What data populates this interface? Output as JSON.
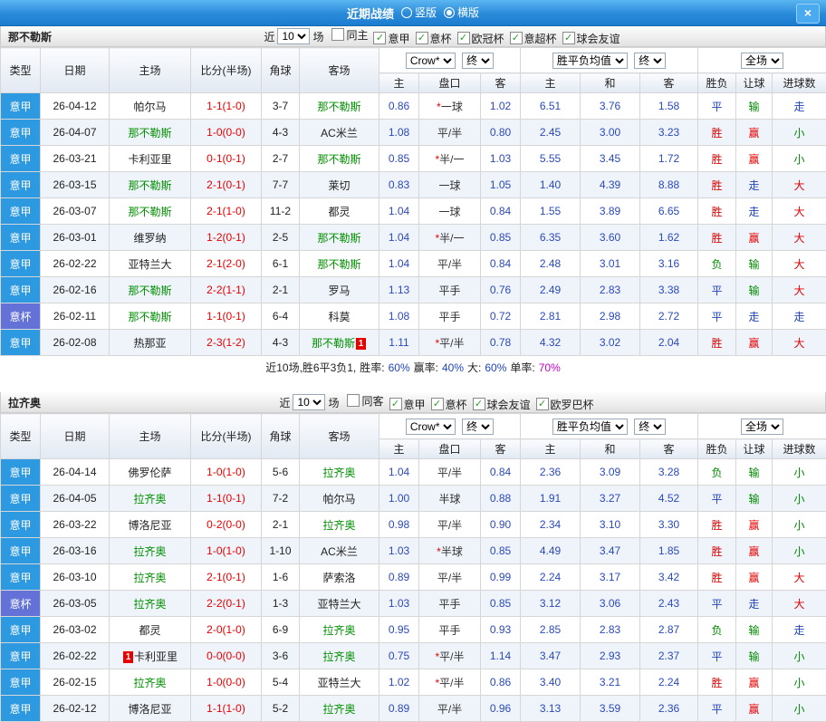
{
  "colors": {
    "red": "#e60000",
    "green": "#008a00",
    "blue": "#2144bd",
    "magenta": "#c400c4"
  },
  "titlebar": {
    "title": "近期战绩",
    "layout_options": [
      {
        "label": "竖版",
        "selected": false
      },
      {
        "label": "横版",
        "selected": true
      }
    ],
    "close_label": "×"
  },
  "filters_common": {
    "recent_label": "近",
    "recent_value": "10",
    "games_label": "场",
    "odds_company": "Crow*",
    "odds_stage": "终",
    "europe_metric": "胜平负均值",
    "europe_stage": "终",
    "scope": "全场"
  },
  "table_headers": {
    "type": "类型",
    "date": "日期",
    "home": "主场",
    "score": "比分(半场)",
    "corner": "角球",
    "away": "客场",
    "asia_home": "主",
    "handicap": "盘口",
    "asia_away": "客",
    "eu_home": "主",
    "eu_draw": "和",
    "eu_away": "客",
    "result": "胜负",
    "handicap_result": "让球",
    "goals": "进球数"
  },
  "sections": [
    {
      "team": "那不勒斯",
      "checkboxes": [
        {
          "label": "同主",
          "checked": false
        },
        {
          "label": "意甲",
          "checked": true
        },
        {
          "label": "意杯",
          "checked": true
        },
        {
          "label": "欧冠杯",
          "checked": true
        },
        {
          "label": "意超杯",
          "checked": true
        },
        {
          "label": "球会友谊",
          "checked": true
        }
      ],
      "rows": [
        {
          "type": "意甲",
          "type_style": "league",
          "date": "26-04-12",
          "home": "帕尔马",
          "home_focus": false,
          "score": "1-1(1-0)",
          "corner": "3-7",
          "away": "那不勒斯",
          "away_focus": true,
          "asia_home": "0.86",
          "handicap": "*一球",
          "asia_away": "1.02",
          "eu_home": "6.51",
          "eu_draw": "3.76",
          "eu_away": "1.58",
          "result": {
            "t": "平",
            "c": "blue"
          },
          "handicap_res": {
            "t": "输",
            "c": "green"
          },
          "goals_res": {
            "t": "走",
            "c": "blue"
          }
        },
        {
          "type": "意甲",
          "type_style": "league",
          "date": "26-04-07",
          "home": "那不勒斯",
          "home_focus": true,
          "score": "1-0(0-0)",
          "corner": "4-3",
          "away": "AC米兰",
          "away_focus": false,
          "asia_home": "1.08",
          "handicap": "平/半",
          "asia_away": "0.80",
          "eu_home": "2.45",
          "eu_draw": "3.00",
          "eu_away": "3.23",
          "result": {
            "t": "胜",
            "c": "red"
          },
          "handicap_res": {
            "t": "赢",
            "c": "red"
          },
          "goals_res": {
            "t": "小",
            "c": "green"
          }
        },
        {
          "type": "意甲",
          "type_style": "league",
          "date": "26-03-21",
          "home": "卡利亚里",
          "home_focus": false,
          "score": "0-1(0-1)",
          "corner": "2-7",
          "away": "那不勒斯",
          "away_focus": true,
          "asia_home": "0.85",
          "handicap": "*半/一",
          "asia_away": "1.03",
          "eu_home": "5.55",
          "eu_draw": "3.45",
          "eu_away": "1.72",
          "result": {
            "t": "胜",
            "c": "red"
          },
          "handicap_res": {
            "t": "赢",
            "c": "red"
          },
          "goals_res": {
            "t": "小",
            "c": "green"
          }
        },
        {
          "type": "意甲",
          "type_style": "league",
          "date": "26-03-15",
          "home": "那不勒斯",
          "home_focus": true,
          "score": "2-1(0-1)",
          "corner": "7-7",
          "away": "莱切",
          "away_focus": false,
          "asia_home": "0.83",
          "handicap": "一球",
          "asia_away": "1.05",
          "eu_home": "1.40",
          "eu_draw": "4.39",
          "eu_away": "8.88",
          "result": {
            "t": "胜",
            "c": "red"
          },
          "handicap_res": {
            "t": "走",
            "c": "blue"
          },
          "goals_res": {
            "t": "大",
            "c": "red"
          }
        },
        {
          "type": "意甲",
          "type_style": "league",
          "date": "26-03-07",
          "home": "那不勒斯",
          "home_focus": true,
          "score": "2-1(1-0)",
          "corner": "11-2",
          "away": "都灵",
          "away_focus": false,
          "asia_home": "1.04",
          "handicap": "一球",
          "asia_away": "0.84",
          "eu_home": "1.55",
          "eu_draw": "3.89",
          "eu_away": "6.65",
          "result": {
            "t": "胜",
            "c": "red"
          },
          "handicap_res": {
            "t": "走",
            "c": "blue"
          },
          "goals_res": {
            "t": "大",
            "c": "red"
          }
        },
        {
          "type": "意甲",
          "type_style": "league",
          "date": "26-03-01",
          "home": "维罗纳",
          "home_focus": false,
          "score": "1-2(0-1)",
          "corner": "2-5",
          "away": "那不勒斯",
          "away_focus": true,
          "asia_home": "1.04",
          "handicap": "*半/一",
          "asia_away": "0.85",
          "eu_home": "6.35",
          "eu_draw": "3.60",
          "eu_away": "1.62",
          "result": {
            "t": "胜",
            "c": "red"
          },
          "handicap_res": {
            "t": "赢",
            "c": "red"
          },
          "goals_res": {
            "t": "大",
            "c": "red"
          }
        },
        {
          "type": "意甲",
          "type_style": "league",
          "date": "26-02-22",
          "home": "亚特兰大",
          "home_focus": false,
          "score": "2-1(2-0)",
          "corner": "6-1",
          "away": "那不勒斯",
          "away_focus": true,
          "asia_home": "1.04",
          "handicap": "平/半",
          "asia_away": "0.84",
          "eu_home": "2.48",
          "eu_draw": "3.01",
          "eu_away": "3.16",
          "result": {
            "t": "负",
            "c": "green"
          },
          "handicap_res": {
            "t": "输",
            "c": "green"
          },
          "goals_res": {
            "t": "大",
            "c": "red"
          }
        },
        {
          "type": "意甲",
          "type_style": "league",
          "date": "26-02-16",
          "home": "那不勒斯",
          "home_focus": true,
          "score": "2-2(1-1)",
          "corner": "2-1",
          "away": "罗马",
          "away_focus": false,
          "asia_home": "1.13",
          "handicap": "平手",
          "asia_away": "0.76",
          "eu_home": "2.49",
          "eu_draw": "2.83",
          "eu_away": "3.38",
          "result": {
            "t": "平",
            "c": "blue"
          },
          "handicap_res": {
            "t": "输",
            "c": "green"
          },
          "goals_res": {
            "t": "大",
            "c": "red"
          }
        },
        {
          "type": "意杯",
          "type_style": "cup",
          "date": "26-02-11",
          "home": "那不勒斯",
          "home_focus": true,
          "score": "1-1(0-1)",
          "corner": "6-4",
          "away": "科莫",
          "away_focus": false,
          "asia_home": "1.08",
          "handicap": "平手",
          "asia_away": "0.72",
          "eu_home": "2.81",
          "eu_draw": "2.98",
          "eu_away": "2.72",
          "result": {
            "t": "平",
            "c": "blue"
          },
          "handicap_res": {
            "t": "走",
            "c": "blue"
          },
          "goals_res": {
            "t": "走",
            "c": "blue"
          }
        },
        {
          "type": "意甲",
          "type_style": "league",
          "date": "26-02-08",
          "home": "热那亚",
          "home_focus": false,
          "score": "2-3(1-2)",
          "corner": "4-3",
          "away": "那不勒斯",
          "away_focus": true,
          "away_badge": "1",
          "asia_home": "1.11",
          "handicap": "*平/半",
          "asia_away": "0.78",
          "eu_home": "4.32",
          "eu_draw": "3.02",
          "eu_away": "2.04",
          "result": {
            "t": "胜",
            "c": "red"
          },
          "handicap_res": {
            "t": "赢",
            "c": "red"
          },
          "goals_res": {
            "t": "大",
            "c": "red"
          }
        }
      ],
      "summary": {
        "prefix": "近10场,胜6平3负1,",
        "stats": [
          {
            "label": "胜率:",
            "value": "60%",
            "color": "blue"
          },
          {
            "label": "赢率:",
            "value": "40%",
            "color": "blue"
          },
          {
            "label": "大:",
            "value": "60%",
            "color": "blue"
          },
          {
            "label": "单率:",
            "value": "70%",
            "color": "magenta"
          }
        ]
      }
    },
    {
      "team": "拉齐奥",
      "checkboxes": [
        {
          "label": "同客",
          "checked": false
        },
        {
          "label": "意甲",
          "checked": true
        },
        {
          "label": "意杯",
          "checked": true
        },
        {
          "label": "球会友谊",
          "checked": true
        },
        {
          "label": "欧罗巴杯",
          "checked": true
        }
      ],
      "rows": [
        {
          "type": "意甲",
          "type_style": "league",
          "date": "26-04-14",
          "home": "佛罗伦萨",
          "home_focus": false,
          "score": "1-0(1-0)",
          "corner": "5-6",
          "away": "拉齐奥",
          "away_focus": true,
          "asia_home": "1.04",
          "handicap": "平/半",
          "asia_away": "0.84",
          "eu_home": "2.36",
          "eu_draw": "3.09",
          "eu_away": "3.28",
          "result": {
            "t": "负",
            "c": "green"
          },
          "handicap_res": {
            "t": "输",
            "c": "green"
          },
          "goals_res": {
            "t": "小",
            "c": "green"
          }
        },
        {
          "type": "意甲",
          "type_style": "league",
          "date": "26-04-05",
          "home": "拉齐奥",
          "home_focus": true,
          "score": "1-1(0-1)",
          "corner": "7-2",
          "away": "帕尔马",
          "away_focus": false,
          "asia_home": "1.00",
          "handicap": "半球",
          "asia_away": "0.88",
          "eu_home": "1.91",
          "eu_draw": "3.27",
          "eu_away": "4.52",
          "result": {
            "t": "平",
            "c": "blue"
          },
          "handicap_res": {
            "t": "输",
            "c": "green"
          },
          "goals_res": {
            "t": "小",
            "c": "green"
          }
        },
        {
          "type": "意甲",
          "type_style": "league",
          "date": "26-03-22",
          "home": "博洛尼亚",
          "home_focus": false,
          "score": "0-2(0-0)",
          "corner": "2-1",
          "away": "拉齐奥",
          "away_focus": true,
          "asia_home": "0.98",
          "handicap": "平/半",
          "asia_away": "0.90",
          "eu_home": "2.34",
          "eu_draw": "3.10",
          "eu_away": "3.30",
          "result": {
            "t": "胜",
            "c": "red"
          },
          "handicap_res": {
            "t": "赢",
            "c": "red"
          },
          "goals_res": {
            "t": "小",
            "c": "green"
          }
        },
        {
          "type": "意甲",
          "type_style": "league",
          "date": "26-03-16",
          "home": "拉齐奥",
          "home_focus": true,
          "score": "1-0(1-0)",
          "corner": "1-10",
          "away": "AC米兰",
          "away_focus": false,
          "asia_home": "1.03",
          "handicap": "*半球",
          "asia_away": "0.85",
          "eu_home": "4.49",
          "eu_draw": "3.47",
          "eu_away": "1.85",
          "result": {
            "t": "胜",
            "c": "red"
          },
          "handicap_res": {
            "t": "赢",
            "c": "red"
          },
          "goals_res": {
            "t": "小",
            "c": "green"
          }
        },
        {
          "type": "意甲",
          "type_style": "league",
          "date": "26-03-10",
          "home": "拉齐奥",
          "home_focus": true,
          "score": "2-1(0-1)",
          "corner": "1-6",
          "away": "萨索洛",
          "away_focus": false,
          "asia_home": "0.89",
          "handicap": "平/半",
          "asia_away": "0.99",
          "eu_home": "2.24",
          "eu_draw": "3.17",
          "eu_away": "3.42",
          "result": {
            "t": "胜",
            "c": "red"
          },
          "handicap_res": {
            "t": "赢",
            "c": "red"
          },
          "goals_res": {
            "t": "大",
            "c": "red"
          }
        },
        {
          "type": "意杯",
          "type_style": "cup",
          "date": "26-03-05",
          "home": "拉齐奥",
          "home_focus": true,
          "score": "2-2(0-1)",
          "corner": "1-3",
          "away": "亚特兰大",
          "away_focus": false,
          "asia_home": "1.03",
          "handicap": "平手",
          "asia_away": "0.85",
          "eu_home": "3.12",
          "eu_draw": "3.06",
          "eu_away": "2.43",
          "result": {
            "t": "平",
            "c": "blue"
          },
          "handicap_res": {
            "t": "走",
            "c": "blue"
          },
          "goals_res": {
            "t": "大",
            "c": "red"
          }
        },
        {
          "type": "意甲",
          "type_style": "league",
          "date": "26-03-02",
          "home": "都灵",
          "home_focus": false,
          "score": "2-0(1-0)",
          "corner": "6-9",
          "away": "拉齐奥",
          "away_focus": true,
          "asia_home": "0.95",
          "handicap": "平手",
          "asia_away": "0.93",
          "eu_home": "2.85",
          "eu_draw": "2.83",
          "eu_away": "2.87",
          "result": {
            "t": "负",
            "c": "green"
          },
          "handicap_res": {
            "t": "输",
            "c": "green"
          },
          "goals_res": {
            "t": "走",
            "c": "blue"
          }
        },
        {
          "type": "意甲",
          "type_style": "league",
          "date": "26-02-22",
          "home": "卡利亚里",
          "home_focus": false,
          "home_badge": "1",
          "score": "0-0(0-0)",
          "corner": "3-6",
          "away": "拉齐奥",
          "away_focus": true,
          "asia_home": "0.75",
          "handicap": "*平/半",
          "asia_away": "1.14",
          "eu_home": "3.47",
          "eu_draw": "2.93",
          "eu_away": "2.37",
          "result": {
            "t": "平",
            "c": "blue"
          },
          "handicap_res": {
            "t": "输",
            "c": "green"
          },
          "goals_res": {
            "t": "小",
            "c": "green"
          }
        },
        {
          "type": "意甲",
          "type_style": "league",
          "date": "26-02-15",
          "home": "拉齐奥",
          "home_focus": true,
          "score": "1-0(0-0)",
          "corner": "5-4",
          "away": "亚特兰大",
          "away_focus": false,
          "asia_home": "1.02",
          "handicap": "*平/半",
          "asia_away": "0.86",
          "eu_home": "3.40",
          "eu_draw": "3.21",
          "eu_away": "2.24",
          "result": {
            "t": "胜",
            "c": "red"
          },
          "handicap_res": {
            "t": "赢",
            "c": "red"
          },
          "goals_res": {
            "t": "小",
            "c": "green"
          }
        },
        {
          "type": "意甲",
          "type_style": "league",
          "date": "26-02-12",
          "home": "博洛尼亚",
          "home_focus": false,
          "score": "1-1(1-0)",
          "corner": "5-2",
          "away": "拉齐奥",
          "away_focus": true,
          "asia_home": "0.89",
          "handicap": "平/半",
          "asia_away": "0.96",
          "eu_home": "3.13",
          "eu_draw": "3.59",
          "eu_away": "2.36",
          "result": {
            "t": "平",
            "c": "blue"
          },
          "handicap_res": {
            "t": "赢",
            "c": "red"
          },
          "goals_res": {
            "t": "小",
            "c": "green"
          }
        }
      ]
    }
  ]
}
